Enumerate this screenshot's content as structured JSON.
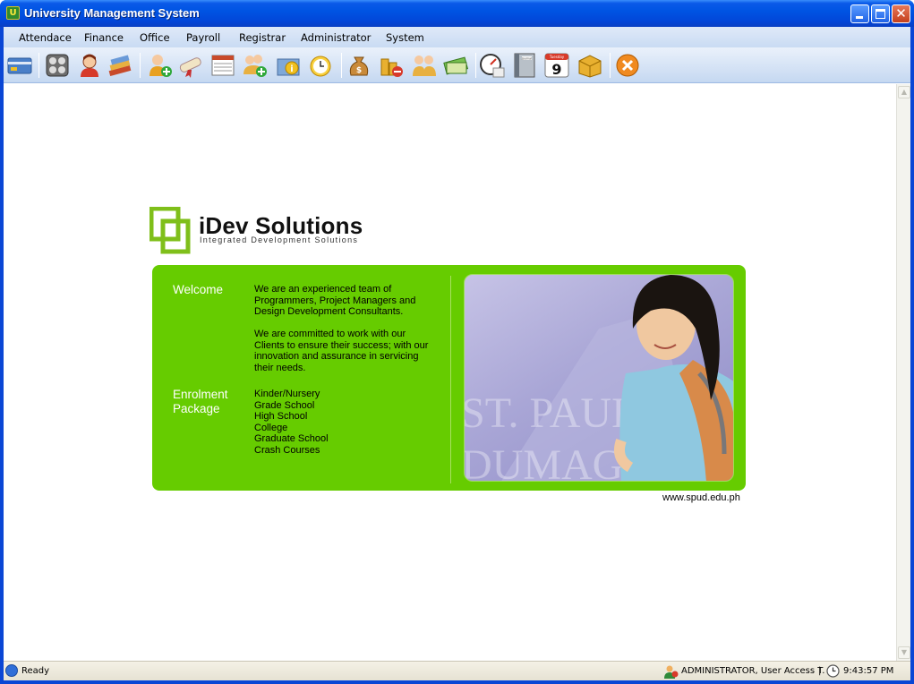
{
  "window": {
    "title": "University Management System",
    "app_icon": "app-logo-icon",
    "controls": [
      "minimize-icon",
      "maximize-icon",
      "close-icon"
    ]
  },
  "menu": {
    "items": [
      "Attendace",
      "Finance",
      "Office",
      "Payroll",
      "Registrar",
      "Administrator",
      "System"
    ]
  },
  "toolbar": {
    "icons": [
      "id-card-icon",
      "calculator-icon",
      "user-female-icon",
      "books-icon",
      "add-user-icon",
      "diploma-icon",
      "schedule-sheet-icon",
      "add-group-icon",
      "info-folder-icon",
      "alarm-clock-icon",
      "money-bag-icon",
      "coins-remove-icon",
      "users-icon",
      "cash-payment-icon",
      "speedometer-report-icon",
      "journal-book-icon",
      "calendar-icon",
      "archive-box-icon",
      "exit-icon"
    ],
    "calendar_day": "9",
    "calendar_weekday": "Tuesday",
    "journal_label": "Journal"
  },
  "banner": {
    "company_name": "iDev Solutions",
    "tagline": "Integrated Development Solutions",
    "welcome_heading": "Welcome",
    "welcome_para1": "We are an experienced team of Programmers, Project Managers and Design Development Consultants.",
    "welcome_para2": "We are committed to work with our Clients to ensure their success; with our innovation and assurance in servicing their needs.",
    "enrolment_heading_1": "Enrolment",
    "enrolment_heading_2": "Package",
    "packages": [
      "Kinder/Nursery",
      "Grade School",
      "High School",
      "College",
      "Graduate School",
      "Crash Courses"
    ],
    "photo_watermark_1": "ST. PAUL",
    "photo_watermark_2": "DUMAG",
    "website": "www.spud.edu.ph",
    "colors": {
      "panel_green": "#66cc00",
      "logo_green": "#7fbf1a"
    }
  },
  "status": {
    "text": "Ready",
    "user": "ADMINISTRATOR, User Access T.",
    "separator": "|",
    "time": "9:43:57 PM"
  }
}
